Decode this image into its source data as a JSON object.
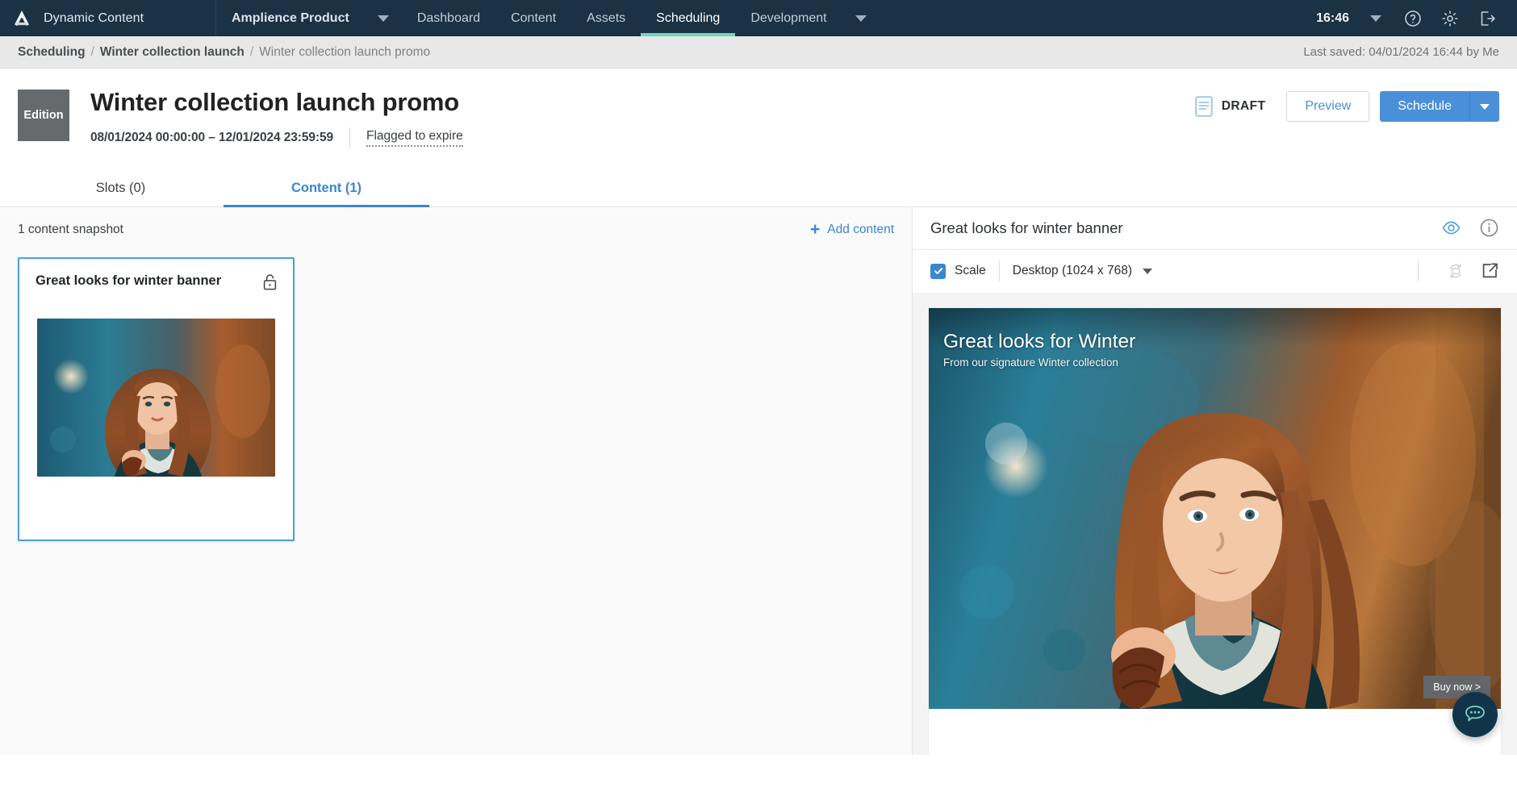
{
  "topnav": {
    "logo_icon": "amplience-logo-icon",
    "brand": "Dynamic Content",
    "hub": "Amplience Product",
    "hub_caret_icon": "chevron-down-icon",
    "items": [
      {
        "label": "Dashboard",
        "active": false
      },
      {
        "label": "Content",
        "active": false
      },
      {
        "label": "Assets",
        "active": false
      },
      {
        "label": "Scheduling",
        "active": true
      },
      {
        "label": "Development",
        "active": false
      }
    ],
    "overflow_caret_icon": "chevron-down-icon",
    "clock": "16:46",
    "clock_caret_icon": "chevron-down-icon",
    "help_icon": "help-circle-icon",
    "settings_icon": "gear-icon",
    "logout_icon": "logout-icon",
    "bg_color": "#1b3144",
    "active_underline_color": "#6fd8bd"
  },
  "breadcrumb": {
    "items": [
      "Scheduling",
      "Winter collection launch",
      "Winter collection launch promo"
    ],
    "separator": "/",
    "last_saved": "Last saved: 04/01/2024 16:44 by Me"
  },
  "header": {
    "badge": "Edition",
    "title": "Winter collection launch promo",
    "date_range": "08/01/2024 00:00:00  –  12/01/2024 23:59:59",
    "flag_label": "Flagged to expire",
    "status": "DRAFT",
    "status_icon": "document-icon",
    "preview_label": "Preview",
    "schedule_label": "Schedule",
    "schedule_caret_icon": "chevron-down-icon",
    "accent_color": "#4a90d9"
  },
  "tabs": [
    {
      "label": "Slots (0)",
      "active": false
    },
    {
      "label": "Content (1)",
      "active": true
    }
  ],
  "left_pane": {
    "snapshot_count_label": "1 content snapshot",
    "add_content_label": "Add content",
    "add_icon": "plus-icon",
    "cards": [
      {
        "title": "Great looks for winter banner",
        "lock_icon": "unlocked-padlock-icon",
        "selected": true
      }
    ]
  },
  "right_pane": {
    "title": "Great looks for winter banner",
    "eye_icon": "eye-icon",
    "info_icon": "info-circle-icon",
    "scale_label": "Scale",
    "scale_checked": true,
    "device": "Desktop (1024 x 768)",
    "device_caret_icon": "chevron-down-icon",
    "rotate_icon": "rotate-device-icon",
    "open_external_icon": "open-in-new-icon",
    "preview": {
      "heading": "Great looks for Winter",
      "subheading": "From our signature Winter collection",
      "cta_label": "Buy now >"
    },
    "chat_icon": "chat-bubble-icon"
  }
}
